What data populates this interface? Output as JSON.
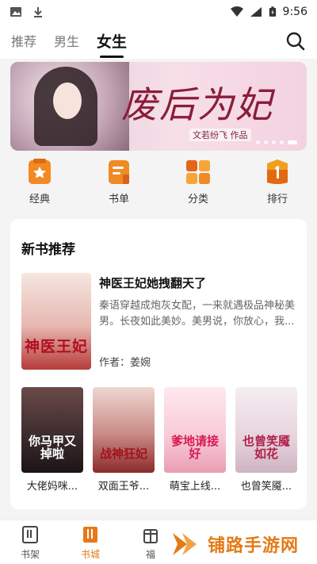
{
  "status_bar": {
    "time": "9:56"
  },
  "top_tabs": [
    "推荐",
    "男生",
    "女生"
  ],
  "active_tab": "女生",
  "banner": {
    "title": "废后为妃",
    "byline": "文若纷飞 作品"
  },
  "quick_links": [
    {
      "label": "经典",
      "icon": "star-bookmark-icon",
      "color": "#f08a24"
    },
    {
      "label": "书单",
      "icon": "list-book-icon",
      "color": "#f08a24"
    },
    {
      "label": "分类",
      "icon": "category-grid-icon",
      "color": "#f08a24"
    },
    {
      "label": "排行",
      "icon": "rank-one-icon",
      "color": "#f0a020"
    }
  ],
  "new_books": {
    "title": "新书推荐",
    "featured": {
      "name": "神医王妃她拽翻天了",
      "description": "秦语穿越成炮灰女配，一来就遇极品神秘美男。长夜如此美妙。美男说，你放心，我...",
      "author": "作者：姜婉",
      "cover_text": "神医王妃"
    },
    "books": [
      {
        "name": "大佬妈咪...",
        "cover_text": "你马甲又掉啦"
      },
      {
        "name": "双面王爷...",
        "cover_text": "战神狂妃"
      },
      {
        "name": "萌宝上线...",
        "cover_text": "爹地请接好"
      },
      {
        "name": "也曾笑魇...",
        "cover_text": "也曾笑魇如花"
      }
    ]
  },
  "bottom_nav": [
    {
      "label": "书架",
      "icon": "bookshelf-icon"
    },
    {
      "label": "书城",
      "icon": "bookstore-icon"
    },
    {
      "label": "福",
      "icon": "welfare-icon"
    }
  ],
  "active_bottom": "书城",
  "watermark": {
    "text": "铺路手游网"
  },
  "colors": {
    "accent": "#e27a1b",
    "text": "#222222"
  }
}
